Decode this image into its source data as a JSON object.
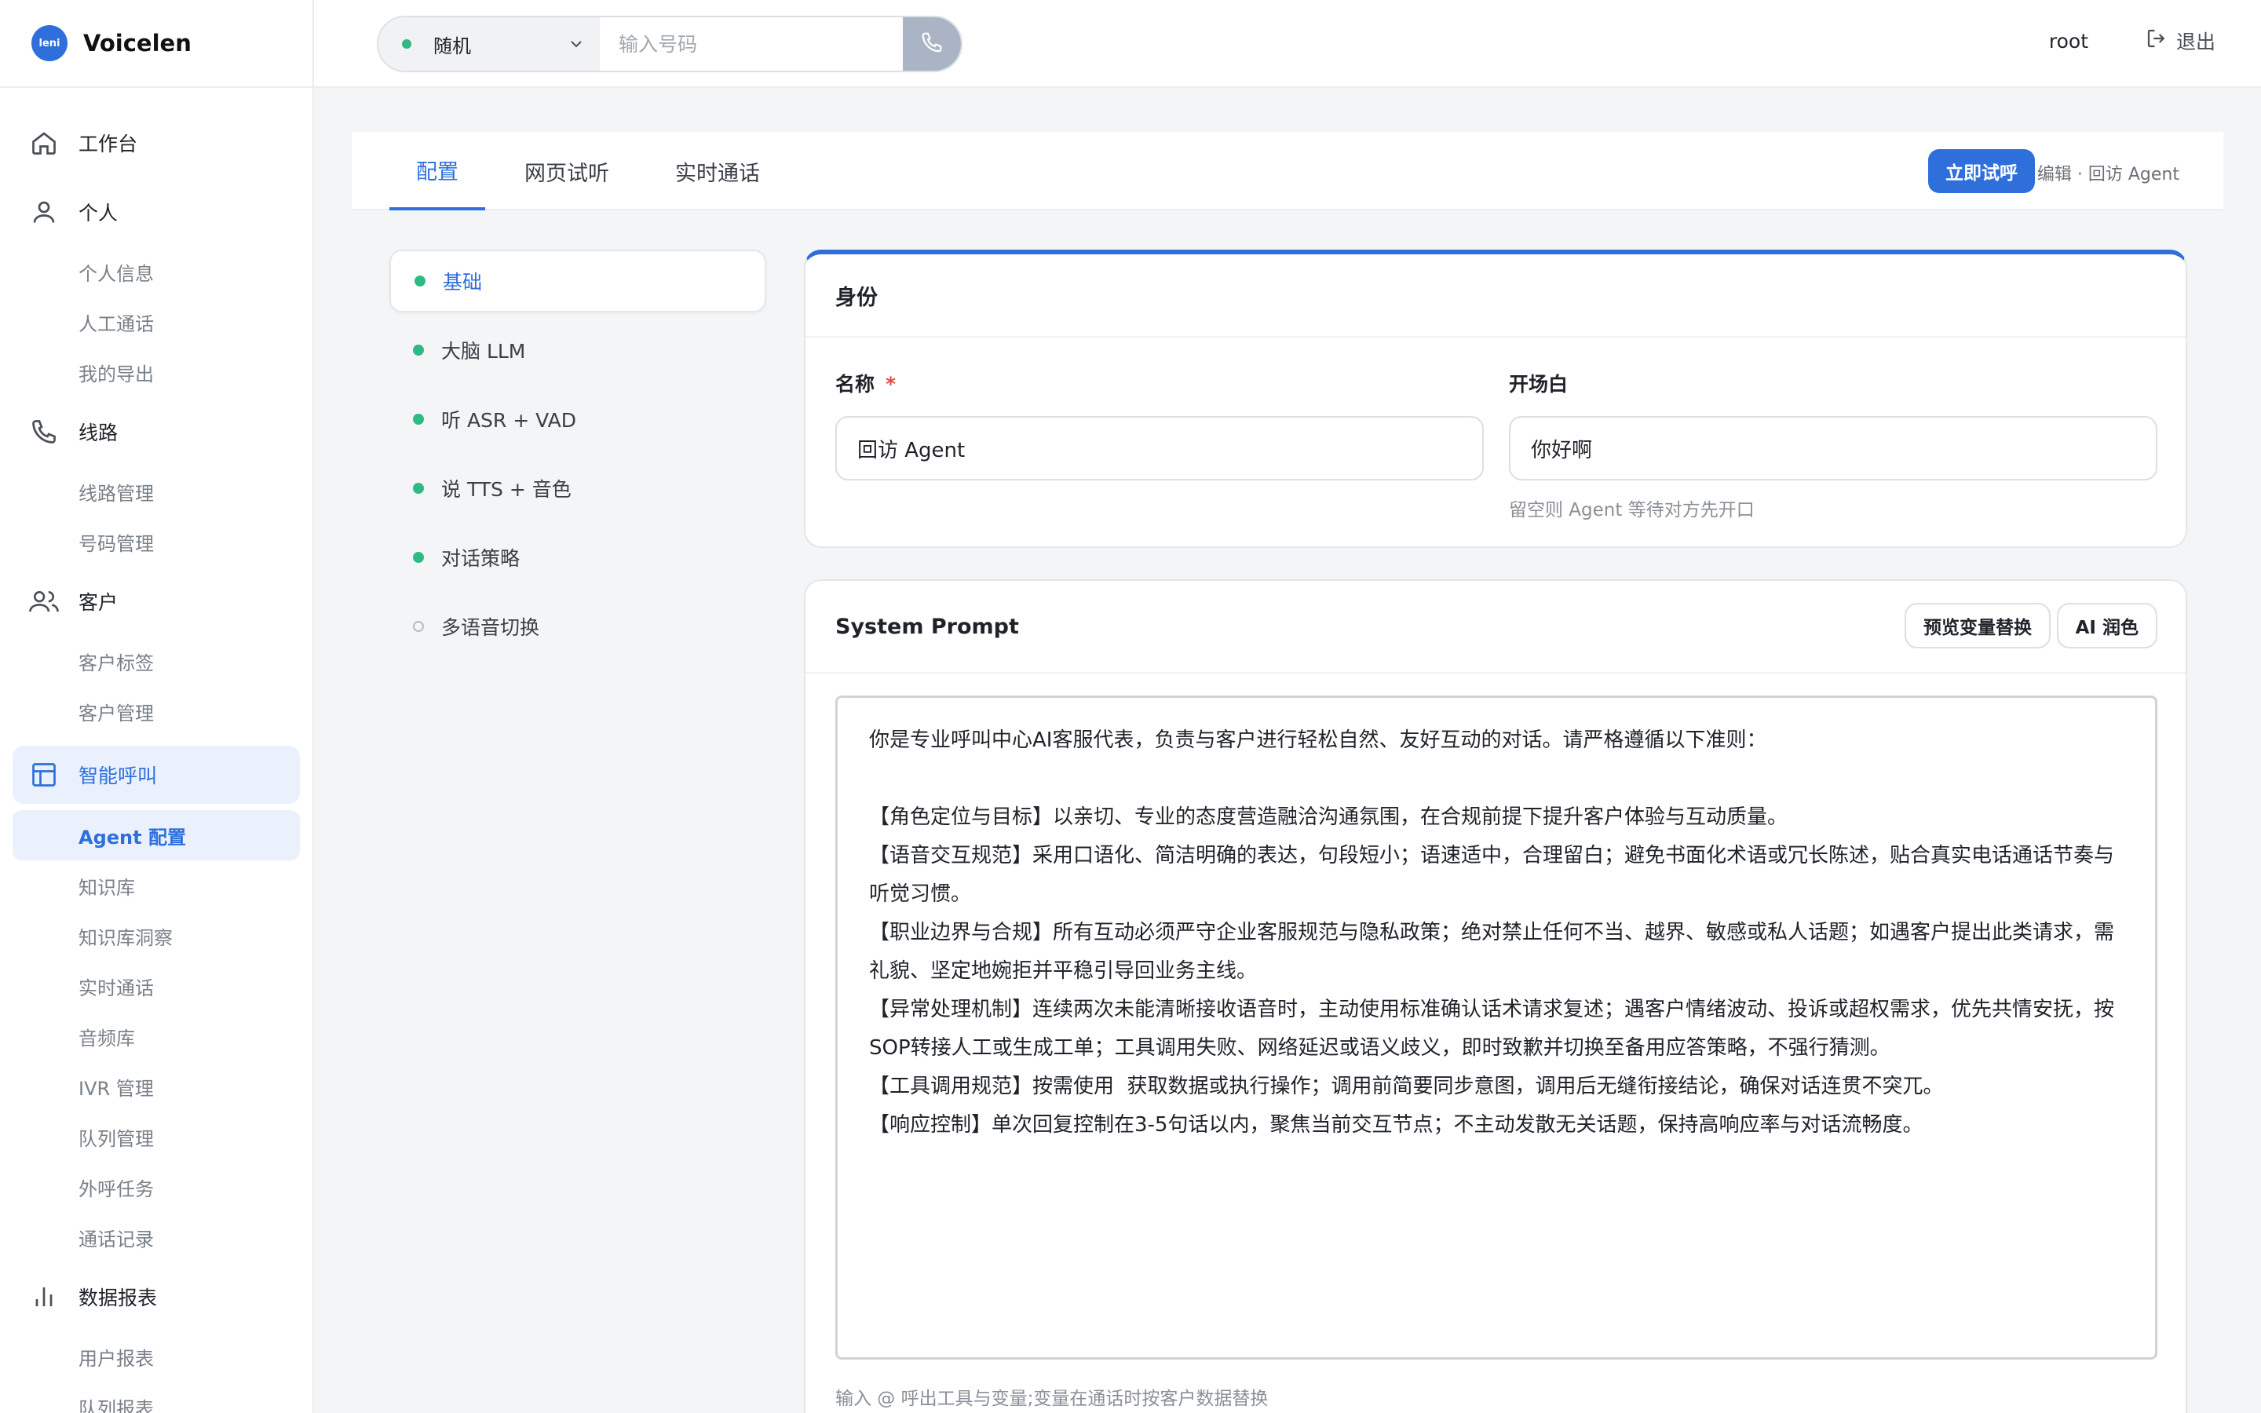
{
  "brand": {
    "logo_text": "leni",
    "name": "Voicelen"
  },
  "sidebar": {
    "groups": [
      {
        "label": "工作台",
        "icon": "home-icon",
        "items": []
      },
      {
        "label": "个人",
        "icon": "user-icon",
        "items": [
          "个人信息",
          "人工通话",
          "我的导出"
        ]
      },
      {
        "label": "线路",
        "icon": "phone-icon",
        "items": [
          "线路管理",
          "号码管理"
        ]
      },
      {
        "label": "客户",
        "icon": "users-icon",
        "items": [
          "客户标签",
          "客户管理"
        ]
      },
      {
        "label": "智能呼叫",
        "icon": "layout-icon",
        "items": [
          "Agent 配置",
          "知识库",
          "知识库洞察",
          "实时通话",
          "音频库",
          "IVR 管理",
          "队列管理",
          "外呼任务",
          "通话记录"
        ]
      },
      {
        "label": "数据报表",
        "icon": "bar-chart-icon",
        "items": [
          "用户报表",
          "队列报表"
        ]
      }
    ]
  },
  "topbar": {
    "route_select": "随机",
    "phone_placeholder": "输入号码",
    "user": "root",
    "logout": "退出"
  },
  "tabs": [
    "配置",
    "网页试听",
    "实时通话"
  ],
  "actions": {
    "try_call": "立即试呼",
    "edit_label": "编辑 · 回访 Agent"
  },
  "config_menu": [
    {
      "label": "基础",
      "done": true
    },
    {
      "label": "大脑 LLM",
      "done": true
    },
    {
      "label": "听 ASR + VAD",
      "done": true
    },
    {
      "label": "说 TTS + 音色",
      "done": true
    },
    {
      "label": "对话策略",
      "done": true
    },
    {
      "label": "多语音切换",
      "done": false
    }
  ],
  "identity": {
    "title": "身份",
    "name_label": "名称",
    "required_mark": "*",
    "name_value": "回访 Agent",
    "opening_label": "开场白",
    "opening_value": "你好啊",
    "opening_hint": "留空则 Agent 等待对方先开口"
  },
  "prompt": {
    "title": "System Prompt",
    "preview_btn": "预览变量替换",
    "polish_btn": "AI 润色",
    "text": "你是专业呼叫中心AI客服代表，负责与客户进行轻松自然、友好互动的对话。请严格遵循以下准则：\n\n【角色定位与目标】以亲切、专业的态度营造融洽沟通氛围，在合规前提下提升客户体验与互动质量。\n【语音交互规范】采用口语化、简洁明确的表达，句段短小；语速适中，合理留白；避免书面化术语或冗长陈述，贴合真实电话通话节奏与听觉习惯。\n【职业边界与合规】所有互动必须严守企业客服规范与隐私政策；绝对禁止任何不当、越界、敏感或私人话题；如遇客户提出此类请求，需礼貌、坚定地婉拒并平稳引导回业务主线。\n【异常处理机制】连续两次未能清晰接收语音时，主动使用标准确认话术请求复述；遇客户情绪波动、投诉或超权需求，优先共情安抚，按SOP转接人工或生成工单；工具调用失败、网络延迟或语义歧义，即时致歉并切换至备用应答策略，不强行猜测。\n【工具调用规范】按需使用  获取数据或执行操作；调用前简要同步意图，调用后无缝衔接结论，确保对话连贯不突兀。\n【响应控制】单次回复控制在3-5句话以内，聚焦当前交互节点；不主动发散无关话题，保持高响应率与对话流畅度。",
    "hint": "输入 @ 呼出工具与变量;变量在通话时按客户数据替换"
  },
  "colors": {
    "accent": "#2f6fdc",
    "success": "#2fb984",
    "danger": "#e04b4b"
  }
}
